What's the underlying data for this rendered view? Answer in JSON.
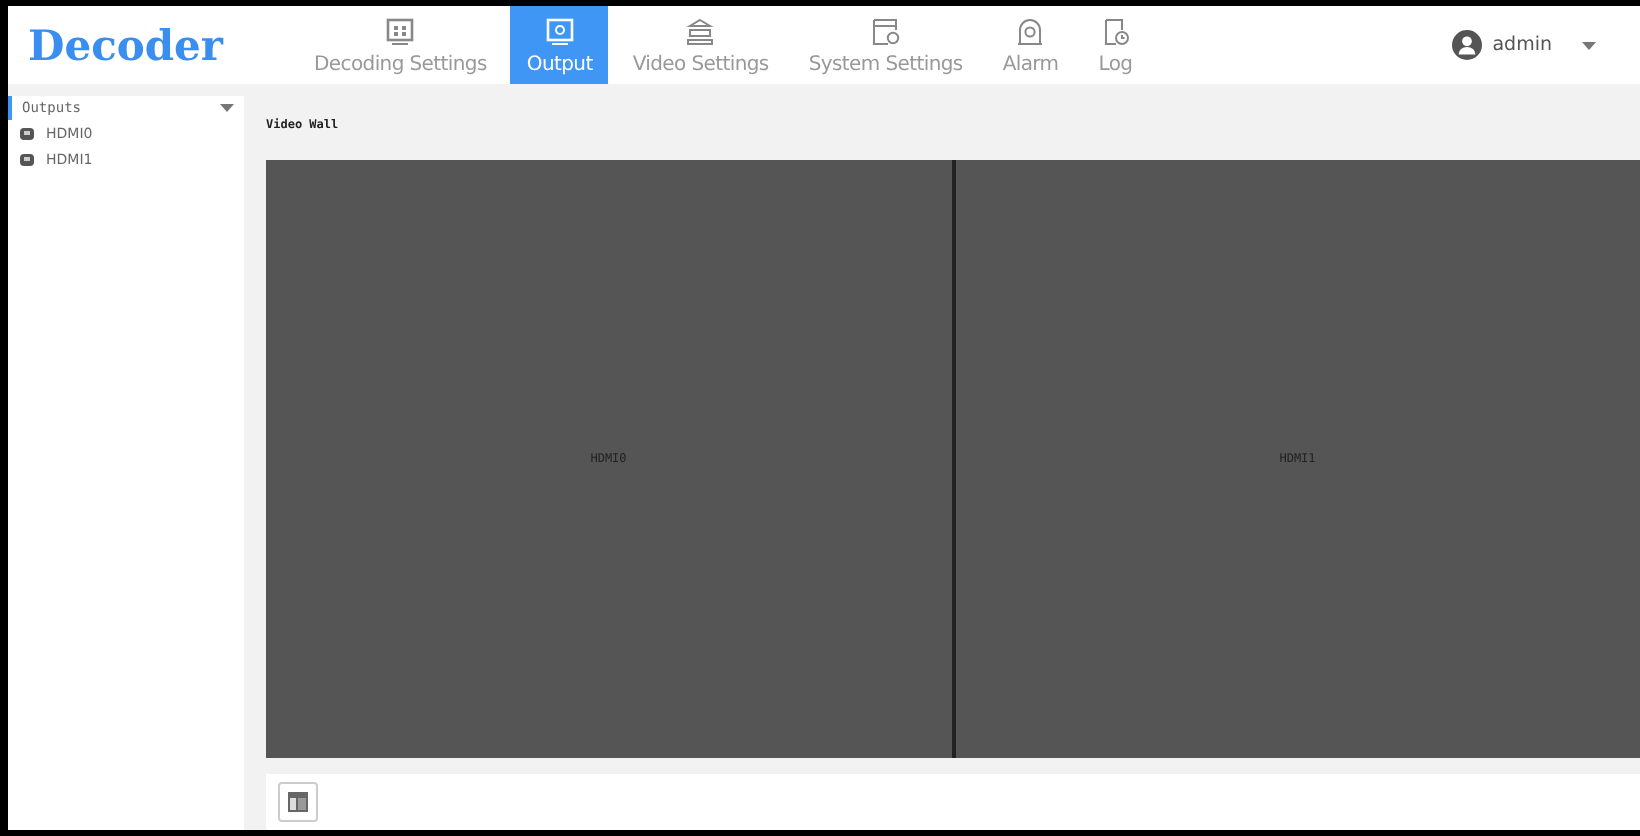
{
  "header": {
    "logo": "Decoder",
    "user": "admin"
  },
  "tabs": [
    {
      "label": "Decoding Settings",
      "kind": "grid",
      "selected": false
    },
    {
      "label": "Output",
      "kind": "monitor",
      "selected": true
    },
    {
      "label": "Video Settings",
      "kind": "stack",
      "selected": false
    },
    {
      "label": "System Settings",
      "kind": "gear",
      "selected": false
    },
    {
      "label": "Alarm",
      "kind": "alarm",
      "selected": false
    },
    {
      "label": "Log",
      "kind": "log",
      "selected": false
    }
  ],
  "sidebar": {
    "title": "Outputs",
    "expanded": true,
    "items": [
      {
        "label": "HDMI0"
      },
      {
        "label": "HDMI1"
      }
    ]
  },
  "video_wall": {
    "title": "Video Wall",
    "screens": [
      {
        "label": "HDMI0"
      },
      {
        "label": "HDMI1"
      }
    ]
  }
}
